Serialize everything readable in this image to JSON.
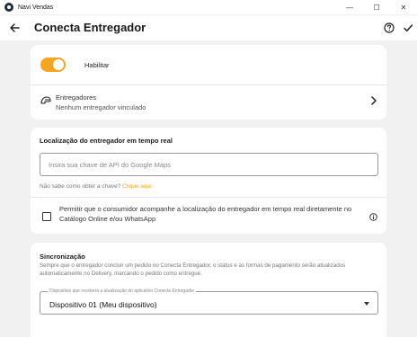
{
  "window": {
    "title": "Navi Vendas",
    "controls": {
      "minimize": "—",
      "maximize": "☐",
      "close": "✕"
    }
  },
  "appbar": {
    "title": "Conecta Entregador",
    "back_icon": "arrow-left-icon",
    "help_icon": "help-circle-icon",
    "confirm_icon": "check-icon"
  },
  "enable_card": {
    "toggle_label": "Habilitar",
    "toggle_on": true,
    "deliverers_title": "Entregadores",
    "deliverers_subtitle": "Nenhum entregador vinculado"
  },
  "location_card": {
    "title": "Localização do entregador em tempo real",
    "api_key_placeholder": "Insira sua chave de API do Google Maps",
    "api_key_value": "",
    "hint_text": "Não sabe como obter a chave?",
    "hint_link": "Clique aqui",
    "permit_text": "Permitir que o consumidor acompanhe a localização do entregador em tempo real diretamente no Catálogo Online e/ou WhatsApp",
    "permit_checked": false
  },
  "sync_card": {
    "title": "Sincronização",
    "description": "Sempre que o entregador concluir um pedido no Conecta Entregador, o status e as formas de pagamento serão atualizados automaticamente no Delivery, marcando o pedido como entregue.",
    "select_label": "Dispositivo que receberá a atualização do aplicativo Conecta Entregador",
    "select_value": "Dispositivo 01 (Meu dispositivo)"
  },
  "colors": {
    "accent": "#f4a621",
    "background": "#f1f1f1",
    "card": "#ffffff"
  }
}
